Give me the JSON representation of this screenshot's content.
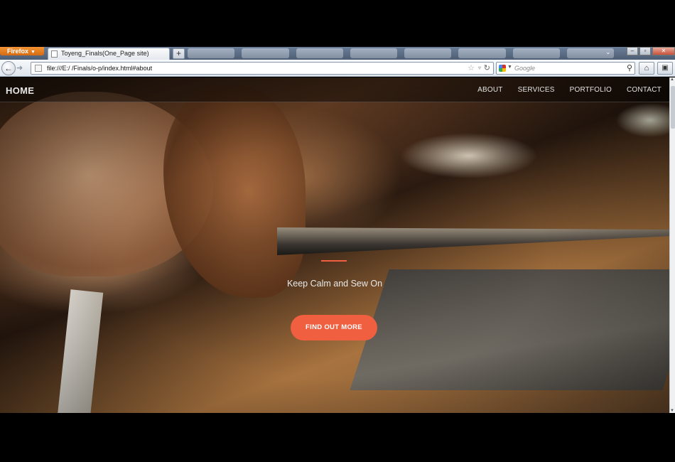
{
  "browser": {
    "menu_button": "Firefox",
    "tab_title": "Toyeng_Finals(One_Page site)",
    "new_tab_symbol": "+",
    "url": "file:///E:/ /Finals/o-p/index.html#about",
    "search_placeholder": "Google"
  },
  "site": {
    "brand": "HOME",
    "nav": [
      "ABOUT",
      "SERVICES",
      "PORTFOLIO",
      "CONTACT"
    ],
    "tagline": "Keep Calm and Sew On",
    "cta": "FIND OUT MORE",
    "accent_color": "#f05f40"
  },
  "icons": [
    "back-arrow-icon",
    "forward-arrow-icon",
    "page-icon",
    "bookmark-star-icon",
    "reload-icon",
    "search-engine-icon",
    "magnifier-icon",
    "home-icon",
    "addon-icon"
  ]
}
